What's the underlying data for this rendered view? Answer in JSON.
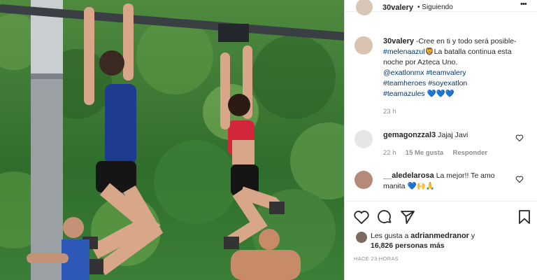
{
  "post": {
    "username": "30valery",
    "follow_status": "Siguiendo",
    "more_glyph": "•••",
    "caption": {
      "username": "30valery",
      "text_1": "-Cree en ti y todo será posible-",
      "hashtag_1": "#melenaazul",
      "text_2": "La batalla continua esta noche por Azteca Uno.",
      "mention_1": "@exatlonmx",
      "hashtag_2": "#teamvalery",
      "hashtag_3": "#teamheroes",
      "hashtag_4": "#soyexatlon",
      "hashtag_5": "#teamazules",
      "hearts": "💙💙💙",
      "lion_emoji": "🦁",
      "time": "23 h"
    },
    "comments": [
      {
        "username": "gemagonzzal3",
        "text": "Jajaj Javi",
        "time": "22 h",
        "likes": "15 Me gusta",
        "reply": "Responder"
      },
      {
        "username": "__aledelarosa",
        "text": "La mejor!! Te amo manita",
        "emojis": "💙🙌🙏"
      }
    ],
    "likes": {
      "prefix": "Les gusta a",
      "user": "adrianmedranor",
      "conj": "y",
      "count": "16,826 personas más"
    },
    "timestamp": "HACE 23 HORAS"
  },
  "icons": {
    "like": "heart-icon",
    "comment": "comment-icon",
    "share": "paper-plane-icon",
    "save": "bookmark-icon",
    "more": "more-icon",
    "comment_like": "heart-icon"
  },
  "colors": {
    "link": "#00376b",
    "text": "#262626",
    "muted": "#8e8e8e",
    "border": "#dbdbdb"
  }
}
